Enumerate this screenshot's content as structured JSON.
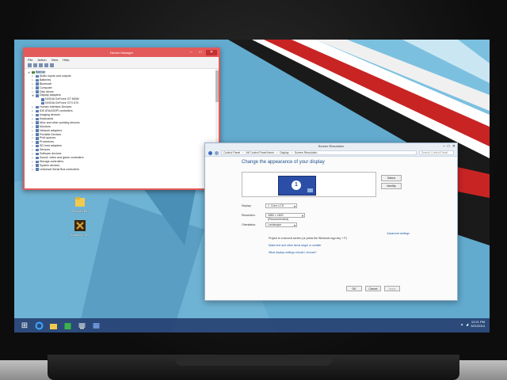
{
  "device_manager": {
    "title": "Device Manager",
    "menu": [
      "File",
      "Action",
      "View",
      "Help"
    ],
    "tree": [
      {
        "label": "Batman",
        "level": 0,
        "expanded": true,
        "selected": true
      },
      {
        "label": "Audio inputs and outputs",
        "level": 1
      },
      {
        "label": "Batteries",
        "level": 1
      },
      {
        "label": "Bluetooth",
        "level": 1
      },
      {
        "label": "Computer",
        "level": 1
      },
      {
        "label": "Disk drives",
        "level": 1
      },
      {
        "label": "Display adapters",
        "level": 1,
        "expanded": true
      },
      {
        "label": "NVIDIA GeForce GT 650M",
        "level": 2
      },
      {
        "label": "NVIDIA GeForce GTX 670",
        "level": 2
      },
      {
        "label": "Human Interface Devices",
        "level": 1
      },
      {
        "label": "IDE ATA/ATAPI controllers",
        "level": 1
      },
      {
        "label": "Imaging devices",
        "level": 1
      },
      {
        "label": "Keyboards",
        "level": 1
      },
      {
        "label": "Mice and other pointing devices",
        "level": 1
      },
      {
        "label": "Monitors",
        "level": 1
      },
      {
        "label": "Network adapters",
        "level": 1
      },
      {
        "label": "Portable Devices",
        "level": 1
      },
      {
        "label": "Print queues",
        "level": 1
      },
      {
        "label": "Processors",
        "level": 1
      },
      {
        "label": "SD host adapters",
        "level": 1
      },
      {
        "label": "Sensors",
        "level": 1
      },
      {
        "label": "Software devices",
        "level": 1
      },
      {
        "label": "Sound, video and game controllers",
        "level": 1
      },
      {
        "label": "Storage controllers",
        "level": 1
      },
      {
        "label": "System devices",
        "level": 1
      },
      {
        "label": "Universal Serial Bus controllers",
        "level": 1
      }
    ]
  },
  "screen_resolution": {
    "title": "Screen Resolution",
    "breadcrumbs": [
      "Control Panel",
      "All Control Panel Items",
      "Display",
      "Screen Resolution"
    ],
    "search_placeholder": "Search Control Panel",
    "heading": "Change the appearance of your display",
    "monitor_number": "1",
    "detect_label": "Detect",
    "identify_label": "Identify",
    "display_label": "Display:",
    "display_value": "1. Color LCD",
    "resolution_label": "Resolution:",
    "resolution_value": "2880 × 1800 (Recommended)",
    "orientation_label": "Orientation:",
    "orientation_value": "Landscape",
    "advanced_link": "Advanced settings",
    "projector_tip": "Project to a second screen (or press the Windows logo key + P)",
    "text_size_link": "Make text and other items larger or smaller",
    "which_settings_link": "What display settings should I choose?",
    "ok_label": "OK",
    "cancel_label": "Cancel",
    "apply_label": "Apply"
  },
  "desktop_icons": [
    {
      "label": "Recycle Bin",
      "icon": "folder-icon"
    },
    {
      "label": "Shadow Fla...",
      "icon": "game-icon"
    }
  ],
  "taskbar": {
    "items": [
      "start-icon",
      "ie-icon",
      "folder-icon",
      "store-icon",
      "device-manager-icon",
      "control-panel-icon"
    ],
    "time": "12:21 PM",
    "date": "3/21/2014"
  },
  "colors": {
    "accent": "#e35a5a",
    "link": "#1e5aa8",
    "taskbar": "#233c6e",
    "wallpaper": "#5fa6c9"
  }
}
